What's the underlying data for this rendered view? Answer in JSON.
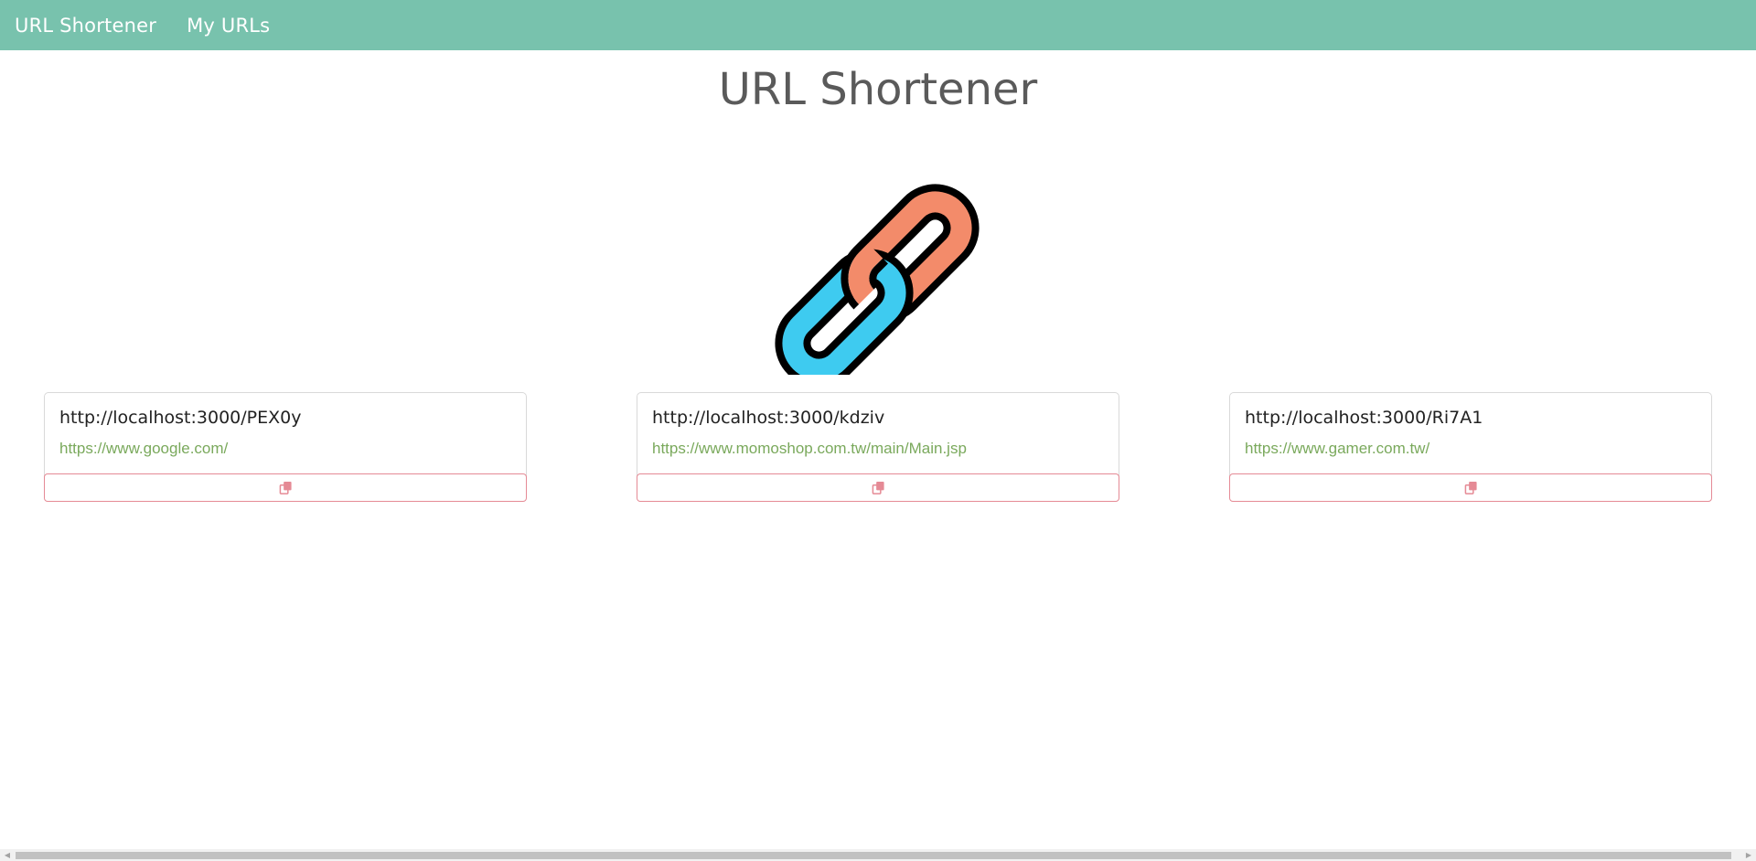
{
  "navbar": {
    "brand": "URL Shortener",
    "links": [
      "My URLs"
    ],
    "background": "#78c2ad"
  },
  "page": {
    "title": "URL Shortener",
    "logo_icon": "chain-link-icon"
  },
  "cards": [
    {
      "short_url": "http://localhost:3000/PEX0y",
      "original_url": "https://www.google.com/",
      "copy_icon": "copy-icon"
    },
    {
      "short_url": "http://localhost:3000/kdziv",
      "original_url": "https://www.momoshop.com.tw/main/Main.jsp",
      "copy_icon": "copy-icon"
    },
    {
      "short_url": "http://localhost:3000/Ri7A1",
      "original_url": "https://www.gamer.com.tw/",
      "copy_icon": "copy-icon"
    }
  ],
  "colors": {
    "accent_green": "#78c2ad",
    "link_green": "#7aa95c",
    "danger_outline": "#e58a95",
    "chain_orange": "#f38b6a",
    "chain_blue": "#3ecbf0"
  }
}
